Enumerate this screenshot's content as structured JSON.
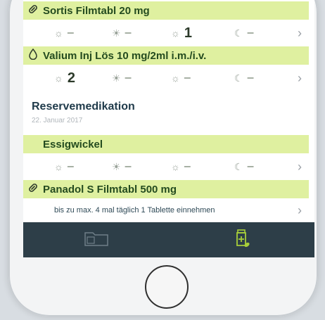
{
  "medications": [
    {
      "name": "Sortis Filmtabl 20 mg",
      "icon": "pill-icon",
      "doses": {
        "morning": "–",
        "noon": "–",
        "evening": "1",
        "night": "–"
      }
    },
    {
      "name": "Valium Inj Lös 10 mg/2ml i.m./i.v.",
      "icon": "droplet-icon",
      "doses": {
        "morning": "2",
        "noon": "–",
        "evening": "–",
        "night": "–"
      }
    }
  ],
  "reserve": {
    "title": "Reservemedikation",
    "date": "22. Januar 2017",
    "items": [
      {
        "name": "Essigwickel",
        "doses": {
          "morning": "–",
          "noon": "–",
          "evening": "–",
          "night": "–"
        }
      },
      {
        "name": "Panadol S Filmtabl 500 mg",
        "icon": "pill-icon",
        "note": "bis zu max. 4 mal täglich 1 Tablette einnehmen"
      }
    ]
  },
  "tabbar": {
    "items": [
      {
        "icon": "folder-icon",
        "active": false
      },
      {
        "icon": "medication-bottle-icon",
        "active": true
      }
    ]
  },
  "colors": {
    "drug_highlight": "#dff0a0",
    "tabbar_bg": "#2d3e48",
    "active_tab_icon": "#a8cf3a"
  }
}
